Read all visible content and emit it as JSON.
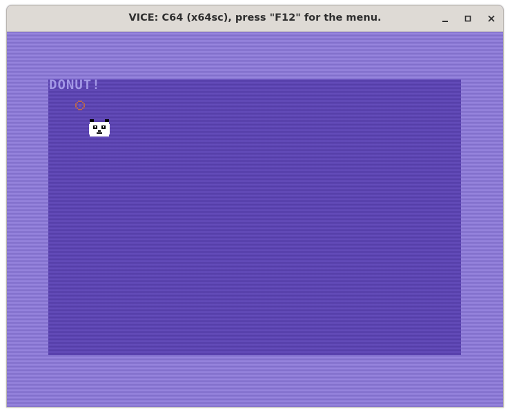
{
  "window": {
    "title": "VICE: C64 (x64sc), press \"F12\" for the menu.",
    "controls": {
      "minimize_icon": "minimize-icon",
      "maximize_icon": "maximize-icon",
      "close_icon": "close-icon"
    }
  },
  "game": {
    "title": "DONUT!",
    "sprites": [
      "donut",
      "panda"
    ]
  },
  "colors": {
    "border": "#8b77da",
    "background": "#5c43b6",
    "title_text": "#a398e6",
    "donut": "#b8674f",
    "panda_white": "#ffffff",
    "panda_black": "#000000",
    "titlebar": "#dedad5"
  }
}
